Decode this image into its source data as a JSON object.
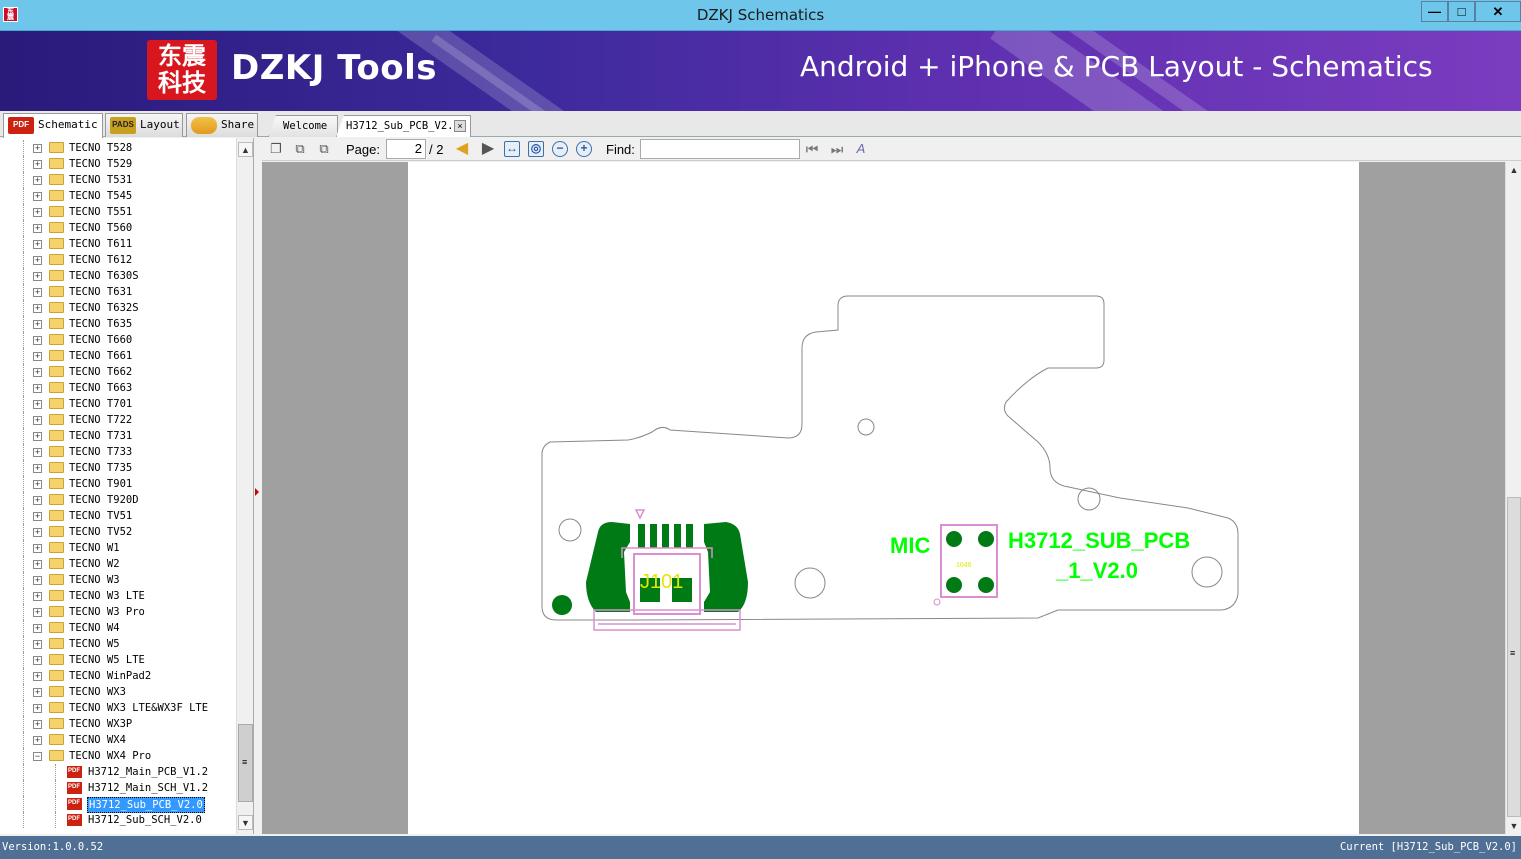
{
  "window": {
    "title": "DZKJ Schematics",
    "icon_label": "东震",
    "minimize_glyph": "—",
    "maximize_glyph": "□",
    "close_glyph": "✕"
  },
  "banner": {
    "logo_line1": "东震",
    "logo_line2": "科技",
    "brand": "DZKJ Tools",
    "slogan": "Android + iPhone & PCB Layout - Schematics"
  },
  "left_tabs": [
    {
      "label": "Schematic",
      "icon": "PDF"
    },
    {
      "label": "Layout",
      "icon": "PADS"
    },
    {
      "label": "Share",
      "icon": ""
    }
  ],
  "doc_tabs": [
    {
      "label": "Welcome"
    },
    {
      "label": "H3712_Sub_PCB_V2.0",
      "close": "×"
    }
  ],
  "tree": {
    "folders": [
      "TECNO T528",
      "TECNO T529",
      "TECNO T531",
      "TECNO T545",
      "TECNO T551",
      "TECNO T560",
      "TECNO T611",
      "TECNO T612",
      "TECNO T630S",
      "TECNO T631",
      "TECNO T632S",
      "TECNO T635",
      "TECNO T660",
      "TECNO T661",
      "TECNO T662",
      "TECNO T663",
      "TECNO T701",
      "TECNO T722",
      "TECNO T731",
      "TECNO T733",
      "TECNO T735",
      "TECNO T901",
      "TECNO T920D",
      "TECNO TV51",
      "TECNO TV52",
      "TECNO W1",
      "TECNO W2",
      "TECNO W3",
      "TECNO W3 LTE",
      "TECNO W3 Pro",
      "TECNO W4",
      "TECNO W5",
      "TECNO W5 LTE",
      "TECNO WinPad2",
      "TECNO WX3",
      "TECNO WX3 LTE&WX3F LTE",
      "TECNO WX3P",
      "TECNO WX4"
    ],
    "expanded_folder": "TECNO WX4 Pro",
    "files": [
      "H3712_Main_PCB_V1.2",
      "H3712_Main_SCH_V1.2",
      "H3712_Sub_PCB_V2.0",
      "H3712_Sub_SCH_V2.0"
    ],
    "selected_file": "H3712_Sub_PCB_V2.0",
    "plus": "+",
    "minus": "−"
  },
  "toolbar": {
    "page_label": "Page:",
    "page_value": "2",
    "page_total": "/ 2",
    "find_label": "Find:",
    "find_value": ""
  },
  "pcb": {
    "connector_label": "J101",
    "mic_label": "MIC",
    "board_name_line1": "H3712_SUB_PCB",
    "board_name_line2": "_1_V2.0",
    "small_text": "1046",
    "copper_color": "#007a14",
    "silkscreen_color": "#00ff00",
    "outline_color": "#d98fd0",
    "refdes_color": "#e6e600"
  },
  "statusbar": {
    "version": "Version:1.0.0.52",
    "current": "Current [H3712_Sub_PCB_V2.0]"
  }
}
